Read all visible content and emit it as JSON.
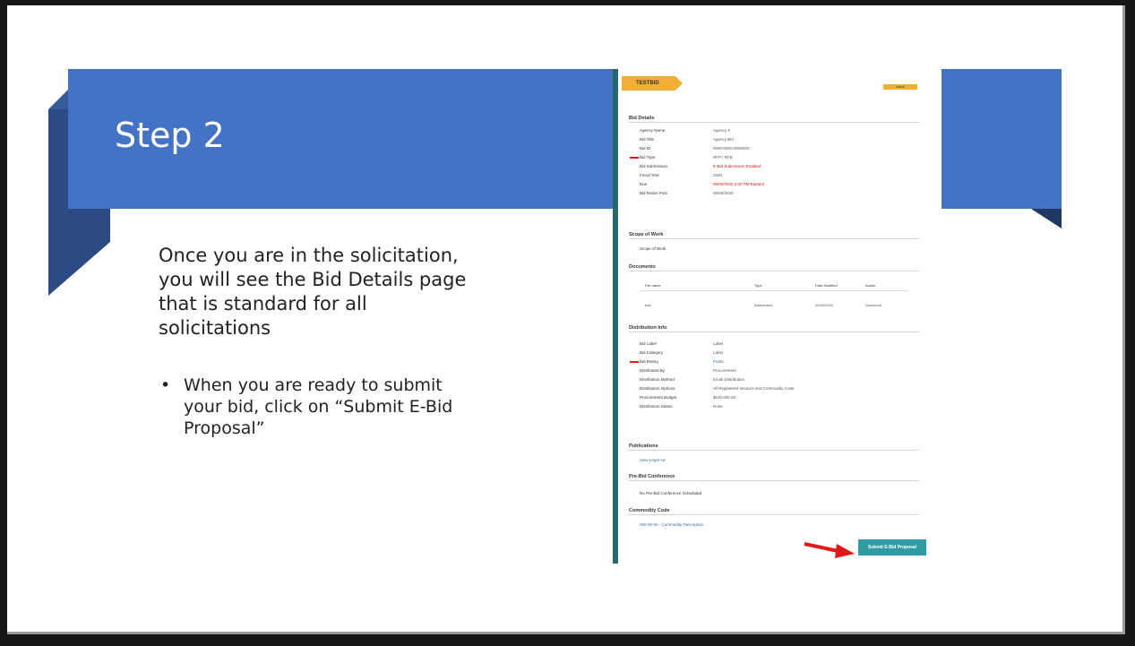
{
  "slide": {
    "title": "Step 2",
    "body": "Once you are in the solicitation, you will see the Bid Details page that is standard for all solicitations",
    "bullets": [
      "When you are ready to submit your bid, click on “Submit E-Bid Proposal”"
    ]
  },
  "screenshot": {
    "bid_tag": "TESTBID",
    "status_badge": "Active",
    "sections": {
      "bid_details": "Bid Details",
      "scope_of_work": "Scope of Work",
      "documents": "Documents",
      "distribution_info": "Distribution Info",
      "publications": "Publications",
      "pre_bid_conference": "Pre-Bid Conference",
      "commodity_code": "Commodity Code"
    },
    "bid_details": [
      {
        "label": "Agency Name",
        "value": "Agency Z"
      },
      {
        "label": "Bid Title",
        "value": "Agency Bid"
      },
      {
        "label": "Bid ID",
        "value": "0000-0000-0000000"
      },
      {
        "label": "Bid Type",
        "value": "RFP / RFB"
      },
      {
        "label": "Bid Submission",
        "value": "E-Bid Submission Enabled"
      },
      {
        "label": "Fiscal Year",
        "value": "2020"
      },
      {
        "label": "Due",
        "value": "00/00/2020 2:00 PM Eastern"
      },
      {
        "label": "Bid Notice Post",
        "value": "00/00/2020"
      }
    ],
    "scope_text": "Scope of Work",
    "documents_table": {
      "columns": [
        "File name",
        "Type",
        "Date Modified",
        "Action"
      ],
      "rows": [
        [
          "test",
          "Attachment",
          "00/00/2020",
          "Download"
        ]
      ]
    },
    "distribution": [
      {
        "label": "Bid Label",
        "value": "Label"
      },
      {
        "label": "Bid Category",
        "value": "Label"
      },
      {
        "label": "Bid Rating",
        "value": "Public"
      },
      {
        "label": "Distributed By",
        "value": "Procurement"
      },
      {
        "label": "Distribution Method",
        "value": "Email Distribution"
      },
      {
        "label": "Distribution Options",
        "value": "All Registered Vendors and Commodity Code"
      },
      {
        "label": "Procurement Budget",
        "value": "$100,000.00"
      },
      {
        "label": "Distribution Status",
        "value": "Done"
      }
    ],
    "publications_text": "View Legal Ad",
    "pre_bid_text": "No Pre-Bid Conference Scheduled",
    "commodity_text": "000-00-00 - Commodity Description",
    "submit_button": "Submit E-Bid Proposal",
    "colors": {
      "accent": "#f0b036",
      "button": "#2f9ba2",
      "arrow": "#e01818",
      "sidebar": "#27676e"
    }
  }
}
